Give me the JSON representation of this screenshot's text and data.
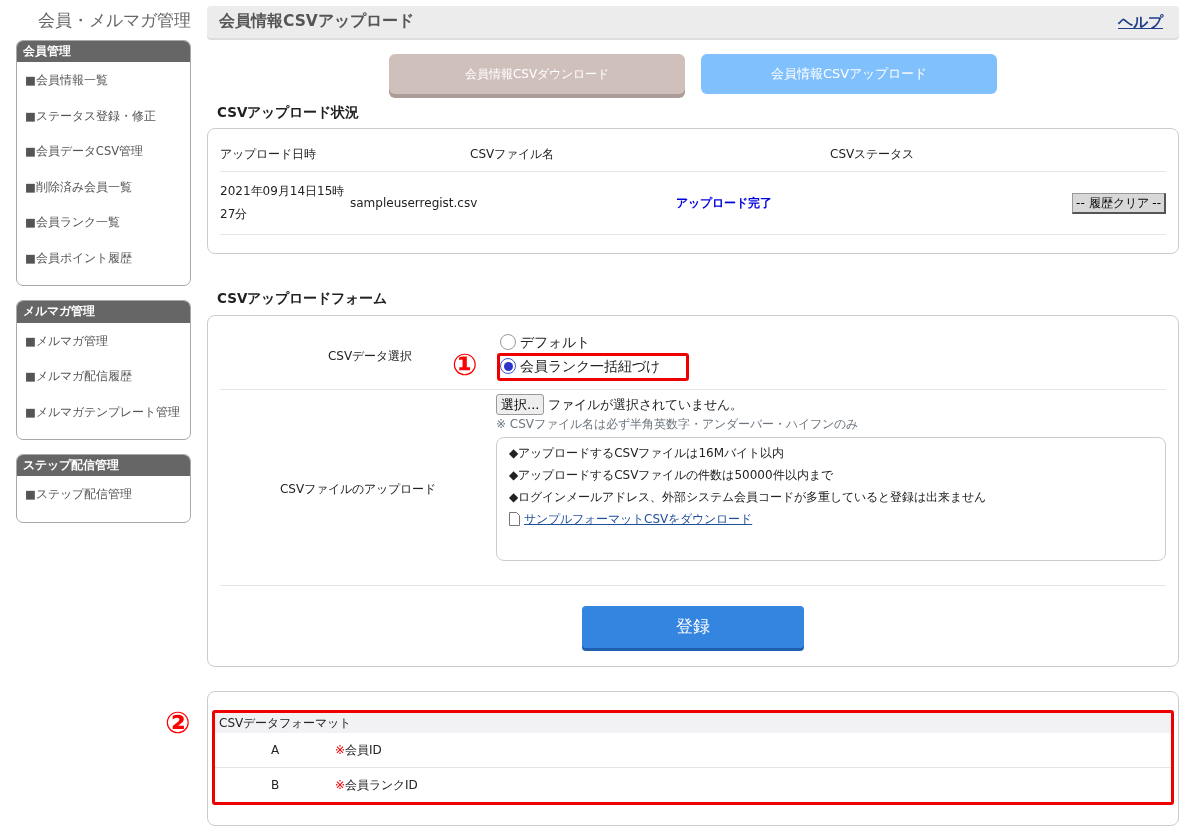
{
  "app_title": "会員・メルマガ管理",
  "sidebar": [
    {
      "title": "会員管理",
      "items": [
        "■会員情報一覧",
        "■ステータス登録・修正",
        "■会員データCSV管理",
        "■削除済み会員一覧",
        "■会員ランク一覧",
        "■会員ポイント履歴"
      ]
    },
    {
      "title": "メルマガ管理",
      "items": [
        "■メルマガ管理",
        "■メルマガ配信履歴",
        "■メルマガテンプレート管理"
      ]
    },
    {
      "title": "ステップ配信管理",
      "items": [
        "■ステップ配信管理"
      ]
    }
  ],
  "page_title": "会員情報CSVアップロード",
  "help_link": "ヘルプ",
  "tabs": [
    {
      "label": "会員情報CSVダウンロード",
      "selected": false
    },
    {
      "label": "会員情報CSVアップロード",
      "selected": true
    }
  ],
  "status_section": {
    "title": "CSVアップロード状況",
    "columns": [
      "アップロード日時",
      "CSVファイル名",
      "CSVステータス"
    ],
    "rows": [
      {
        "datetime": "2021年09月14日15時27分",
        "filename": "sampleuserregist.csv",
        "status": "アップロード完了",
        "action": "-- 履歴クリア --"
      }
    ]
  },
  "form_section": {
    "title": "CSVアップロードフォーム",
    "data_select": {
      "label": "CSVデータ選択",
      "options": [
        {
          "label": "デフォルト",
          "selected": false
        },
        {
          "label": "会員ランク一括紐づけ",
          "selected": true,
          "annotation": "①"
        }
      ]
    },
    "file_upload": {
      "label": "CSVファイルのアップロード",
      "button": "選択...",
      "file_status": "ファイルが選択されていません。",
      "hint": "※ CSVファイル名は必ず半角英数字・アンダーバー・ハイフンのみ",
      "notes": [
        "◆アップロードするCSVファイルは16Mバイト以内",
        "◆アップロードするCSVファイルの件数は50000件以内まで",
        "◆ログインメールアドレス、外部システム会員コードが多重していると登録は出来ません"
      ],
      "sample_link": "サンプルフォーマットCSVをダウンロード"
    },
    "submit": "登録"
  },
  "format_section": {
    "annotation": "②",
    "title": "CSVデータフォーマット",
    "rows": [
      {
        "column": "A",
        "required": "※",
        "field": "会員ID"
      },
      {
        "column": "B",
        "required": "※",
        "field": "会員ランクID"
      }
    ]
  }
}
